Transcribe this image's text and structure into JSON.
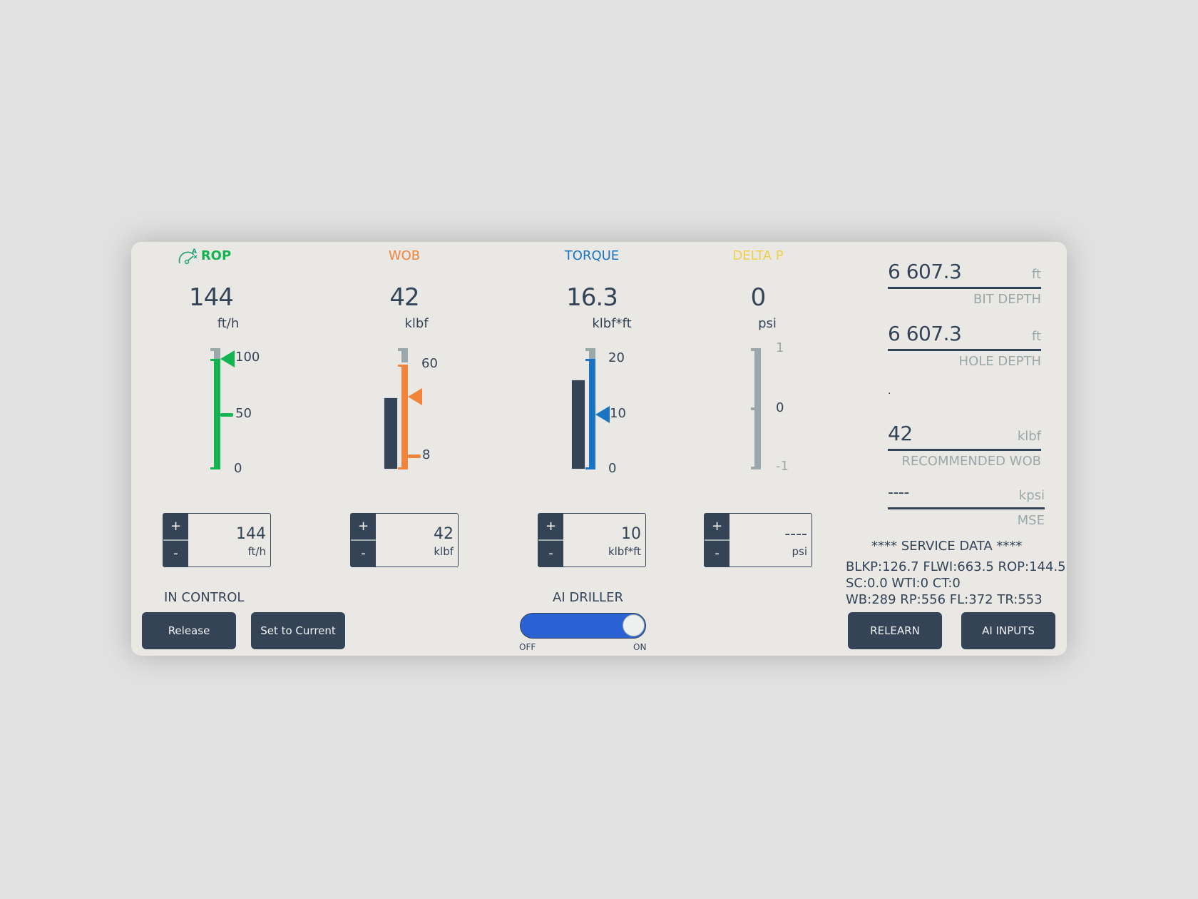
{
  "gauges": [
    {
      "id": "rop",
      "title": "ROP",
      "color": "#14b453",
      "value": "144",
      "unit": "ft/h",
      "scale_min": 0,
      "scale_max": 100,
      "ticks": [
        {
          "label": "100",
          "value": 100
        },
        {
          "label": "50",
          "value": 50
        },
        {
          "label": "0",
          "value": 0
        }
      ],
      "limit_low": 0,
      "limit_high": 100,
      "setpoint": 100,
      "setpoint_tick": 50,
      "actual_bar": null,
      "icon": "autodriller-gauge-icon",
      "stepper": {
        "value": "144",
        "unit": "ft/h",
        "plus": "+",
        "minus": "-"
      }
    },
    {
      "id": "wob",
      "title": "WOB",
      "color": "#f0843a",
      "value": "42",
      "unit": "klbf",
      "scale_min": 0,
      "scale_max": 65,
      "ticks": [
        {
          "label": "60",
          "value": 60
        },
        {
          "label": "8",
          "value": 8
        }
      ],
      "limit_low": 0,
      "limit_high": 60,
      "setpoint": 42,
      "setpoint_tick": 8,
      "actual_bar": 42,
      "stepper": {
        "value": "42",
        "unit": "klbf",
        "plus": "+",
        "minus": "-"
      }
    },
    {
      "id": "torque",
      "title": "TORQUE",
      "color": "#1a74c4",
      "value": "16.3",
      "unit": "klbf*ft",
      "scale_min": 0,
      "scale_max": 21,
      "ticks": [
        {
          "label": "20",
          "value": 20
        },
        {
          "label": "10",
          "value": 10
        },
        {
          "label": "0",
          "value": 0
        }
      ],
      "limit_low": 0,
      "limit_high": 20,
      "setpoint": 10,
      "setpoint_tick": null,
      "actual_bar": 16.3,
      "stepper": {
        "value": "10",
        "unit": "klbf*ft",
        "plus": "+",
        "minus": "-"
      }
    },
    {
      "id": "deltap",
      "title": "DELTA P",
      "color": "#efd04a",
      "value": "0",
      "unit": "psi",
      "scale_min": -1,
      "scale_max": 1,
      "ticks": [
        {
          "label": "1",
          "value": 1,
          "muted": true
        },
        {
          "label": "0",
          "value": 0
        },
        {
          "label": "-1",
          "value": -1,
          "muted": true
        }
      ],
      "limit_low": null,
      "limit_high": null,
      "setpoint": null,
      "setpoint_tick": 0,
      "actual_bar": null,
      "stepper": {
        "value": "----",
        "unit": "psi",
        "plus": "+",
        "minus": "-"
      }
    }
  ],
  "control": {
    "label": "IN CONTROL",
    "release_label": "Release",
    "set_current_label": "Set to Current"
  },
  "ai_driller": {
    "label": "AI DRILLER",
    "state": "on",
    "off_label": "OFF",
    "on_label": "ON",
    "color": "#2a62d3"
  },
  "fields": {
    "bit_depth": {
      "value": "6 607.3",
      "unit": "ft",
      "label": "BIT DEPTH"
    },
    "hole_depth": {
      "value": "6 607.3",
      "unit": "ft",
      "label": "HOLE DEPTH"
    },
    "status_dot": ".",
    "recommended_wob": {
      "value": "42",
      "unit": "klbf",
      "label": "RECOMMENDED WOB"
    },
    "mse": {
      "value": "----",
      "unit": "kpsi",
      "label": "MSE"
    }
  },
  "service_data": {
    "title": "**** SERVICE DATA ****",
    "lines": [
      "BLKP:126.7 FLWI:663.5 ROP:144.5",
      "SC:0.0 WTI:0 CT:0",
      "WB:289 RP:556 FL:372 TR:553"
    ]
  },
  "buttons": {
    "relearn": "RELEARN",
    "ai_inputs": "AI INPUTS"
  },
  "colors": {
    "dark": "#344456",
    "muted": "#9aa8a9",
    "panel": "#eae8e5"
  }
}
